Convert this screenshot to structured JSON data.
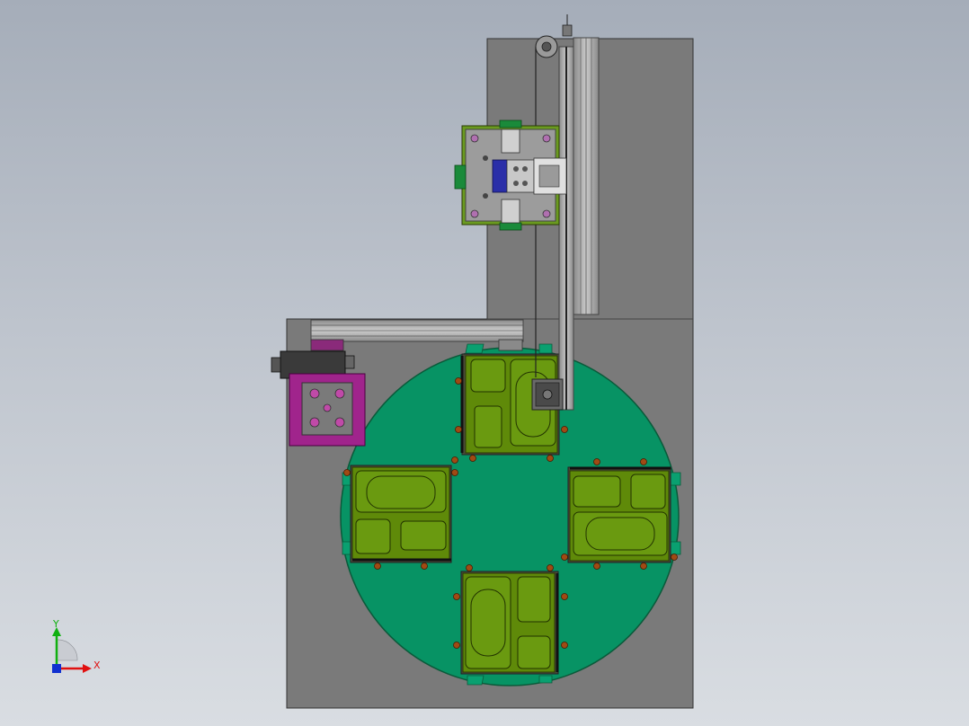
{
  "viewport": {
    "background_top": "#a5adb9",
    "background_bottom": "#d9dde2"
  },
  "model": {
    "base_plate_color": "#7a7a7a",
    "turntable_color": "#079364",
    "tray_color": "#5f8a09",
    "fixture_color": "#9c9c9c",
    "clamp_base_color": "#a0248c",
    "fixture_frame_color": "#6a9a20",
    "cylinder_color": "#2a2ea8",
    "pin_color": "#a04a14",
    "tray_stations": 4
  },
  "triad": {
    "x_label": "X",
    "y_label": "Y",
    "x_color": "#e01010",
    "y_color": "#10b010",
    "z_color": "#1030d0"
  }
}
